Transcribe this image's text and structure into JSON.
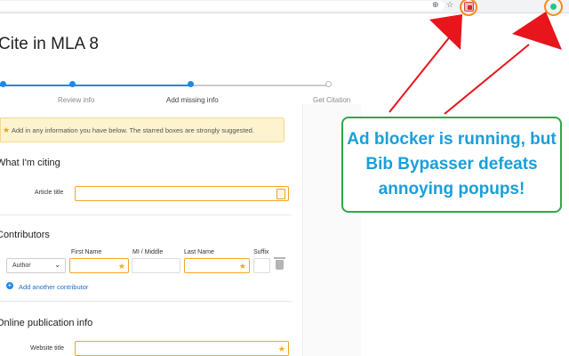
{
  "browser": {
    "toolbar_icons": [
      "zoom-icon",
      "star-icon",
      "extension-icon",
      "profile-icon"
    ],
    "zoom_glyph": "⊕",
    "star_glyph": "☆"
  },
  "page": {
    "title": "Cite in MLA 8",
    "steps": [
      {
        "label": "Review info",
        "status": "done"
      },
      {
        "label": "Add missing info",
        "status": "current"
      },
      {
        "label": "Get Citation",
        "status": "todo"
      }
    ],
    "notice": "Add in any information you have below. The starred boxes are strongly suggested.",
    "sections": {
      "citing": "What I'm citing",
      "contributors": "Contributors",
      "online": "Online publication info"
    },
    "fields": {
      "article_title": "Article title",
      "website_title": "Website title",
      "first_name": "First Name",
      "mi": "MI / Middle",
      "last_name": "Last Name",
      "suffix": "Suffix"
    },
    "contributor_role": "Author",
    "add_contributor": "Add another contributor"
  },
  "callout": {
    "lines": [
      "Ad blocker is running, but",
      "Bib Bypasser defeats",
      "annoying popups!"
    ]
  },
  "colors": {
    "accent_blue": "#1e88e5",
    "star_orange": "#f5a623",
    "arrow_red": "#e8151c",
    "callout_border": "#2fa84a",
    "callout_text": "#1a9fd8"
  }
}
